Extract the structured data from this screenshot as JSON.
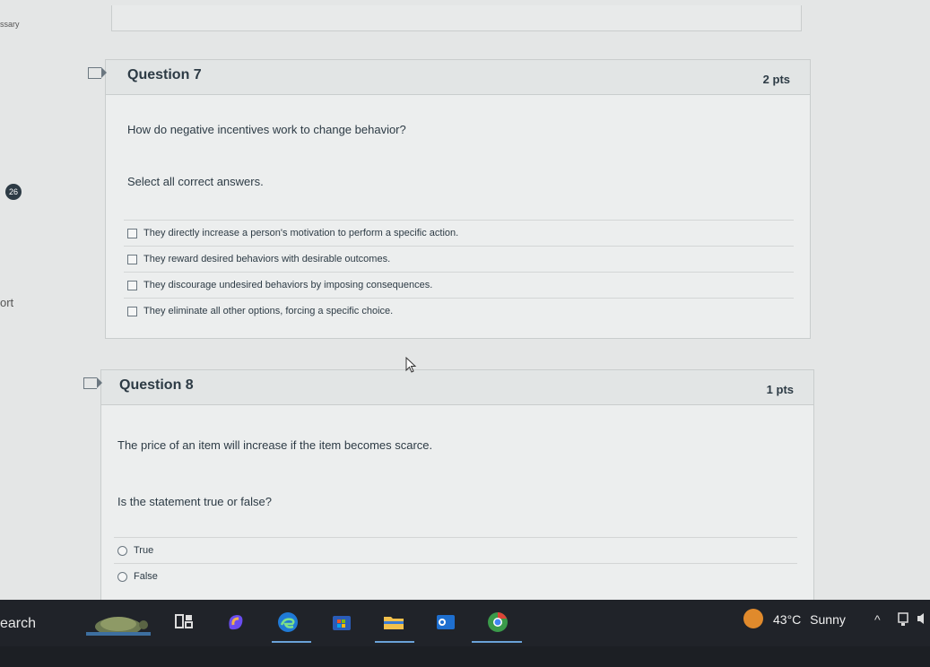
{
  "left_labels": {
    "top": "ssary",
    "mid": "ort"
  },
  "badge": "26",
  "question7": {
    "title": "Question 7",
    "points": "2 pts",
    "prompt": "How do negative incentives work to change behavior?",
    "instruction": "Select all correct answers.",
    "answers": [
      "They directly increase a person's motivation to perform a specific action.",
      "They reward desired behaviors with desirable outcomes.",
      "They discourage undesired behaviors by imposing consequences.",
      "They eliminate all other options, forcing a specific choice."
    ]
  },
  "question8": {
    "title": "Question 8",
    "points": "1 pts",
    "prompt": "The price of an item will increase if the item becomes scarce.",
    "instruction": "Is the statement true or false?",
    "answers": [
      "True",
      "False"
    ]
  },
  "taskbar": {
    "search": "earch",
    "weather_temp": "43°C",
    "weather_desc": "Sunny",
    "icons": [
      "widgets-icon",
      "copilot-icon",
      "edge-icon",
      "store-icon",
      "file-explorer-icon",
      "outlook-icon",
      "chrome-icon"
    ],
    "colors": {
      "edge": "#1f7ad6",
      "copilot": "#6a4df0",
      "store": "#2a5cb8",
      "explorer": "#f2c04b",
      "outlook": "#1e6fcf",
      "chrome": "#3a9a4a"
    }
  }
}
